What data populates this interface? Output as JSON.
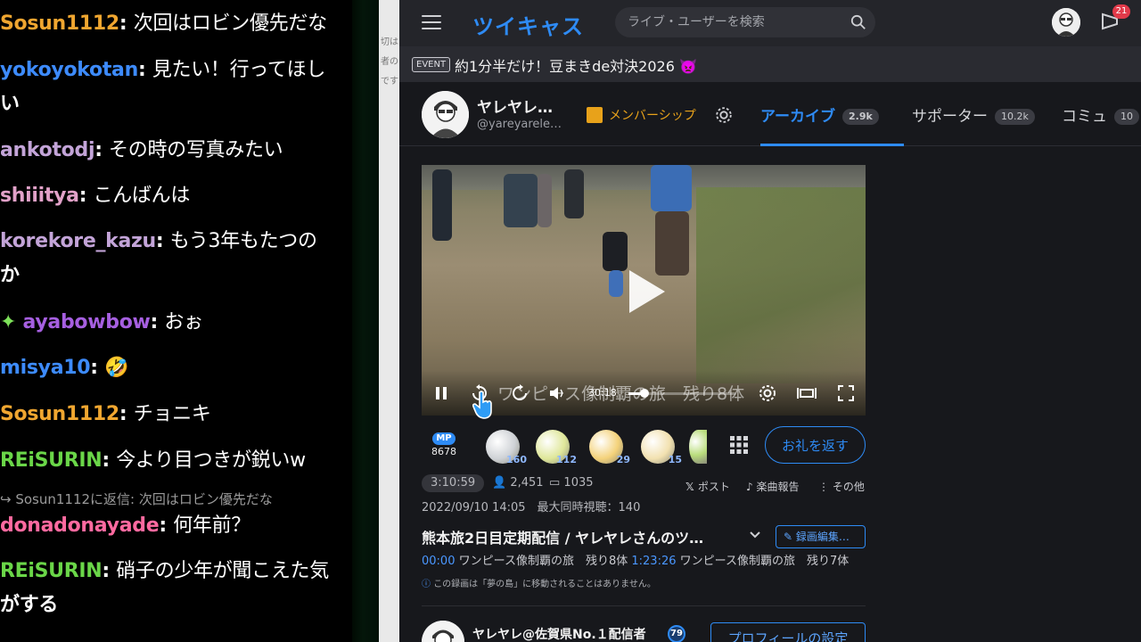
{
  "chat": {
    "messages": [
      {
        "user": "Sosun1112",
        "text": "次回はロビン優先だな",
        "color": "#f0a630",
        "cont": ""
      },
      {
        "user": "yokoyokotan",
        "text": "見たい！行ってほし",
        "color": "#3d8bfd",
        "cont": "い"
      },
      {
        "user": "ankotodj",
        "text": "その時の写真みたい",
        "color": "#c3a4d8",
        "cont": ""
      },
      {
        "user": "shiiitya",
        "text": "こんばんは",
        "color": "#e1a1c8",
        "cont": ""
      },
      {
        "user": "korekore_kazu",
        "text": "もう3年もたつの",
        "color": "#c3a4d8",
        "cont": "か"
      },
      {
        "user": "ayabowbow",
        "text": "おぉ",
        "color": "#a65fe0",
        "cont": ""
      },
      {
        "user": "misya10",
        "text": "🤣",
        "color": "#3d8bfd",
        "cont": ""
      },
      {
        "user": "Sosun1112",
        "text": "チョニキ",
        "color": "#f0a630",
        "cont": ""
      },
      {
        "user": "REiSURIN",
        "text": "今より目つきが鋭いw",
        "color": "#6ad648",
        "cont": ""
      },
      {
        "user": "donadonayade",
        "text": "何年前？",
        "color": "#ff6aa0",
        "cont": ""
      },
      {
        "user": "REiSURIN",
        "text": "硝子の少年が聞こえた気",
        "color": "#6ad648",
        "cont": "がする"
      }
    ],
    "reply_note": "Sosun1112に返信: 次回はロビン優先だな"
  },
  "gap_text": [
    "切は",
    "者の",
    "です"
  ],
  "header": {
    "logo": "ツイキャス",
    "search_placeholder": "ライブ・ユーザーを検索",
    "notif_count": "21"
  },
  "event": {
    "tag": "EVENT",
    "text": "約1分半だけ！豆まきde対決2026 👿"
  },
  "profile": {
    "name": "ヤレヤレ…",
    "handle": "@yareyarele…",
    "membership_label": "メンバーシップ"
  },
  "tabs": [
    {
      "label": "アーカイブ",
      "count": "2.9k",
      "active": true
    },
    {
      "label": "サポーター",
      "count": "10.2k",
      "active": false
    },
    {
      "label": "コミュ",
      "count": "10",
      "active": false
    }
  ],
  "player": {
    "overlay_title": "ワンピース像制覇の旅　残り8体",
    "time": "30:18",
    "progress": 0.15
  },
  "gifts": {
    "mp_label": "MP",
    "mp_value": "8678",
    "items": [
      {
        "name": "silver-capsule",
        "count": "160",
        "color": "#cfd2d6"
      },
      {
        "name": "tea-10",
        "count": "112",
        "color": "#dfe79a"
      },
      {
        "name": "yellow-ball",
        "count": "29",
        "color": "#f4d27a"
      },
      {
        "name": "cup-gift",
        "count": "15",
        "color": "#f2e1b0"
      },
      {
        "name": "tea-10b",
        "count": "",
        "color": "#b9dd7c"
      }
    ],
    "thanks_label": "お礼を返す"
  },
  "stats": {
    "duration": "3:10:59",
    "viewers": "2,451",
    "comments": "1035",
    "post": "ポスト",
    "music": "楽曲報告",
    "more": "その他",
    "date_line": "2022/09/10 14:05　最大同時視聴：140"
  },
  "video": {
    "title": "熊本旅2日目定期配信 / ヤレヤレさんのツ…",
    "edit_label": "録画編集…",
    "chapters": [
      {
        "ts": "00:00",
        "text": "ワンピース像制覇の旅　残り8体"
      },
      {
        "ts": "1:23:26",
        "text": "ワンピース像制覇の旅　残り7体"
      }
    ],
    "note": "この録画は「夢の島」に移動されることはありません。"
  },
  "bottom": {
    "name": "ヤレヤレ@佐賀県No.１配信者",
    "level": "79",
    "profile_button": "プロフィールの設定"
  }
}
